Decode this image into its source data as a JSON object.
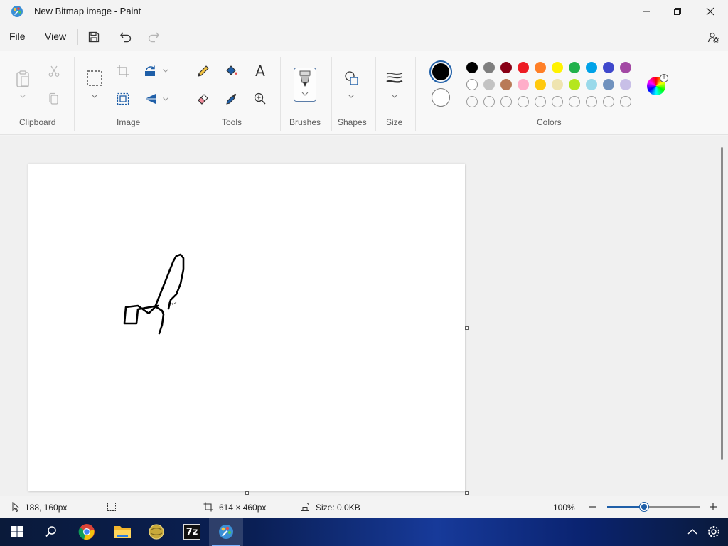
{
  "window": {
    "title": "New Bitmap image - Paint"
  },
  "menu": {
    "file": "File",
    "view": "View"
  },
  "ribbon": {
    "groups": {
      "clipboard": "Clipboard",
      "image": "Image",
      "tools": "Tools",
      "brushes": "Brushes",
      "shapes": "Shapes",
      "size": "Size",
      "colors": "Colors"
    },
    "text_tool_glyph": "A"
  },
  "colors": {
    "primary": "#000000",
    "secondary": "#ffffff",
    "palette_row1": [
      "#000000",
      "#7f7f7f",
      "#880015",
      "#ed1c24",
      "#ff7f27",
      "#fff200",
      "#22b14c",
      "#00a2e8",
      "#3f48cc",
      "#a349a4"
    ],
    "palette_row2": [
      "#ffffff",
      "#c3c3c3",
      "#b97a57",
      "#ffaec9",
      "#ffc90e",
      "#efe4b0",
      "#b5e61d",
      "#99d9ea",
      "#7092be",
      "#c8bfe7"
    ],
    "palette_row3_count": 10
  },
  "status": {
    "cursor_pos": "188, 160px",
    "canvas_size": "614 × 460px",
    "file_size": "Size: 0.0KB",
    "zoom": "100%",
    "zoom_level": 0.4
  },
  "taskbar": {
    "apps": [
      "start-icon",
      "search-icon",
      "chrome-icon",
      "file-explorer-icon",
      "app-icon",
      "7zip-icon",
      "paint-icon"
    ],
    "sevenzip_label": "7z"
  }
}
